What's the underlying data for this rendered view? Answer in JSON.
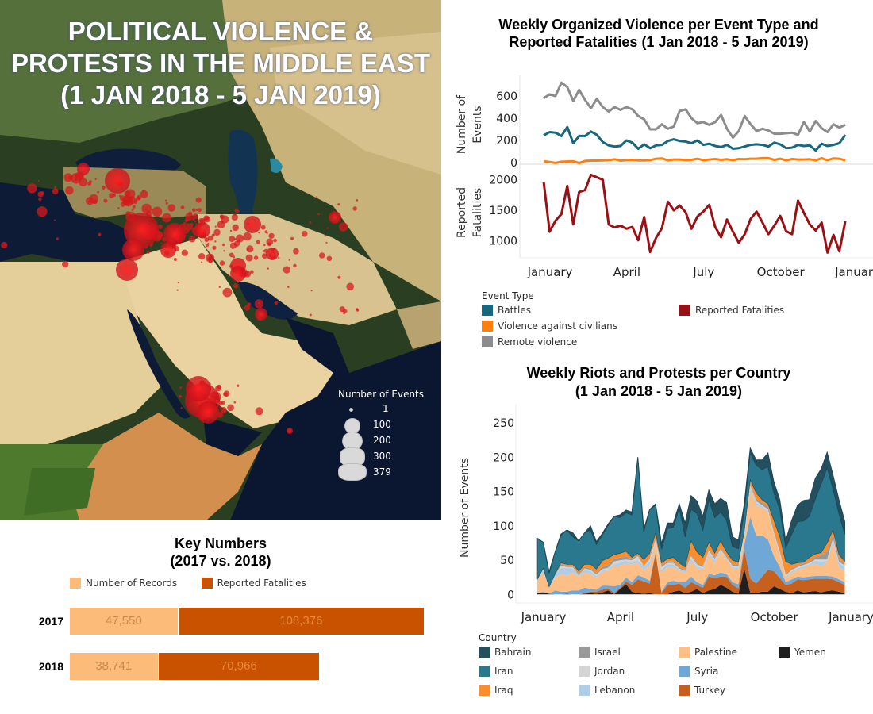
{
  "map": {
    "title_lines": [
      "POLITICAL VIOLENCE &",
      "PROTESTS IN THE MIDDLE EAST",
      "(1 JAN 2018 - 5 JAN 2019)"
    ],
    "legend": {
      "title": "Number of Events",
      "entries": [
        {
          "label": "1",
          "value": 1
        },
        {
          "label": "100",
          "value": 100
        },
        {
          "label": "200",
          "value": 200
        },
        {
          "label": "300",
          "value": 300
        },
        {
          "label": "379",
          "value": 379
        }
      ]
    },
    "marker_color": "#d7191c"
  },
  "key_numbers": {
    "title_lines": [
      "Key Numbers",
      "(2017 vs. 2018)"
    ],
    "legend": [
      {
        "label": "Number of Records",
        "color": "#fdbb7a"
      },
      {
        "label": "Reported Fatalities",
        "color": "#c85200"
      }
    ]
  },
  "violence": {
    "title_lines": [
      "Weekly Organized Violence per Event Type and",
      "Reported Fatalities (1 Jan 2018 - 5 Jan 2019)"
    ],
    "legend_title": "Event Type",
    "legend": [
      {
        "label": "Battles",
        "color": "#17677e"
      },
      {
        "label": "Violence against civilians",
        "color": "#ff7f0e"
      },
      {
        "label": "Remote violence",
        "color": "#8c8c8c"
      }
    ],
    "fatalities_legend": {
      "label": "Reported Fatalities",
      "color": "#9b1015"
    }
  },
  "protests": {
    "title_lines": [
      "Weekly Riots and Protests per Country",
      "(1 Jan 2018 - 5 Jan 2019)"
    ],
    "legend_title": "Country"
  },
  "chart_data": [
    {
      "type": "bar",
      "title": "Key Numbers (2017 vs. 2018)",
      "stacked": true,
      "orientation": "horizontal",
      "categories": [
        "2017",
        "2018"
      ],
      "series": [
        {
          "name": "Number of Records",
          "values": [
            47550,
            38741
          ],
          "labels": [
            "47,550",
            "38,741"
          ],
          "color": "#fdbb7a"
        },
        {
          "name": "Reported Fatalities",
          "values": [
            108376,
            70966
          ],
          "labels": [
            "108,376",
            "70,966"
          ],
          "color": "#c85200"
        }
      ]
    },
    {
      "type": "line",
      "title": "Weekly Organized Violence per Event Type (Number of Events)",
      "ylabel": "Number of Events",
      "ylim": [
        0,
        750
      ],
      "yticks": [
        0,
        200,
        400,
        600
      ],
      "x_month_labels": [
        {
          "label": "January",
          "week": 1
        },
        {
          "label": "April",
          "week": 14
        },
        {
          "label": "July",
          "week": 27
        },
        {
          "label": "October",
          "week": 40
        },
        {
          "label": "January",
          "week": 53
        }
      ],
      "x_weeks": 54,
      "series": [
        {
          "name": "Remote violence",
          "color": "#8c8c8c",
          "values": [
            580,
            615,
            600,
            720,
            680,
            555,
            655,
            565,
            490,
            575,
            500,
            460,
            500,
            475,
            500,
            480,
            420,
            390,
            300,
            300,
            345,
            305,
            325,
            465,
            480,
            400,
            355,
            365,
            340,
            365,
            430,
            305,
            225,
            285,
            420,
            345,
            285,
            305,
            290,
            260,
            260,
            265,
            270,
            250,
            365,
            280,
            375,
            310,
            275,
            345,
            315,
            340
          ]
        },
        {
          "name": "Battles",
          "color": "#17677e",
          "values": [
            245,
            275,
            270,
            240,
            320,
            175,
            240,
            240,
            280,
            250,
            185,
            155,
            145,
            150,
            200,
            180,
            125,
            165,
            130,
            155,
            160,
            195,
            210,
            195,
            190,
            175,
            200,
            160,
            170,
            150,
            140,
            160,
            125,
            130,
            145,
            160,
            165,
            160,
            145,
            180,
            165,
            130,
            135,
            160,
            150,
            155,
            110,
            170,
            150,
            160,
            175,
            250
          ]
        },
        {
          "name": "Violence against civilians",
          "color": "#ff7f0e",
          "values": [
            12,
            6,
            -2,
            8,
            10,
            12,
            -3,
            15,
            18,
            18,
            20,
            22,
            30,
            18,
            22,
            25,
            20,
            20,
            22,
            35,
            38,
            20,
            28,
            28,
            22,
            25,
            35,
            22,
            28,
            32,
            25,
            30,
            22,
            32,
            30,
            35,
            35,
            40,
            40,
            25,
            35,
            20,
            32,
            28,
            28,
            30,
            20,
            40,
            22,
            38,
            35,
            20
          ]
        }
      ]
    },
    {
      "type": "line",
      "title": "Reported Fatalities (weekly)",
      "ylabel": "Reported Fatalities",
      "ylim": [
        750,
        2150
      ],
      "yticks": [
        1000,
        1500,
        2000
      ],
      "x_weeks": 54,
      "series": [
        {
          "name": "Reported Fatalities",
          "color": "#9b1015",
          "values": [
            1970,
            1150,
            1330,
            1440,
            1900,
            1270,
            1800,
            1830,
            2080,
            2040,
            2000,
            1270,
            1220,
            1250,
            1200,
            1230,
            1010,
            1390,
            820,
            1050,
            1210,
            1640,
            1500,
            1580,
            1470,
            1200,
            1400,
            1480,
            1590,
            1230,
            1060,
            1350,
            1150,
            970,
            1110,
            1360,
            1480,
            1300,
            1110,
            1250,
            1410,
            1160,
            1110,
            1660,
            1460,
            1270,
            1170,
            1300,
            810,
            1100,
            830,
            1320
          ]
        }
      ]
    },
    {
      "type": "area",
      "stacked": true,
      "title": "Weekly Riots and Protests per Country (1 Jan 2018 - 5 Jan 2019)",
      "ylabel": "Number of Events",
      "ylim": [
        -10,
        265
      ],
      "yticks": [
        0,
        50,
        100,
        150,
        200,
        250
      ],
      "x_month_labels": [
        {
          "label": "January",
          "week": 1
        },
        {
          "label": "April",
          "week": 14
        },
        {
          "label": "July",
          "week": 27
        },
        {
          "label": "October",
          "week": 40
        },
        {
          "label": "January",
          "week": 53
        }
      ],
      "x_weeks": 54,
      "legend_order": [
        "Bahrain",
        "Israel",
        "Palestine",
        "Yemen",
        "Iran",
        "Jordan",
        "Syria",
        "Iraq",
        "Lebanon",
        "Turkey"
      ],
      "series": [
        {
          "name": "Yemen",
          "color": "#1f1f1f",
          "values": [
            2,
            3,
            1,
            -2,
            0,
            1,
            -1,
            -1,
            1,
            2,
            1,
            3,
            6,
            0,
            8,
            15,
            4,
            2,
            1,
            2,
            -6,
            0,
            0,
            4,
            6,
            2,
            4,
            8,
            2,
            6,
            8,
            14,
            10,
            4,
            1,
            38,
            3,
            2,
            4,
            4,
            12,
            8,
            4,
            2,
            6,
            3,
            4,
            5,
            3,
            5,
            6,
            4,
            2
          ]
        },
        {
          "name": "Turkey",
          "color": "#c8601d",
          "values": [
            0,
            0,
            0,
            0,
            0,
            0,
            0,
            0,
            1,
            2,
            3,
            4,
            3,
            2,
            2,
            4,
            10,
            20,
            18,
            14,
            60,
            2,
            14,
            10,
            10,
            8,
            14,
            6,
            8,
            20,
            16,
            12,
            16,
            10,
            8,
            28,
            20,
            14,
            22,
            32,
            22,
            16,
            10,
            14,
            16,
            18,
            18,
            18,
            20,
            18,
            16,
            14,
            12
          ]
        },
        {
          "name": "Syria",
          "color": "#6fa7d6",
          "values": [
            0,
            1,
            0,
            6,
            4,
            3,
            6,
            6,
            8,
            4,
            3,
            6,
            4,
            10,
            4,
            6,
            4,
            6,
            6,
            4,
            2,
            2,
            4,
            6,
            2,
            8,
            8,
            4,
            4,
            4,
            4,
            6,
            4,
            4,
            6,
            6,
            90,
            70,
            60,
            44,
            22,
            16,
            4,
            6,
            4,
            4,
            4,
            4,
            4,
            4,
            4,
            4,
            4
          ]
        },
        {
          "name": "Palestine",
          "color": "#fdbf86",
          "values": [
            20,
            28,
            10,
            18,
            26,
            24,
            26,
            20,
            22,
            22,
            18,
            20,
            22,
            30,
            28,
            20,
            26,
            18,
            10,
            22,
            14,
            28,
            22,
            20,
            16,
            14,
            22,
            20,
            22,
            28,
            18,
            30,
            22,
            20,
            22,
            10,
            40,
            44,
            40,
            40,
            30,
            18,
            6,
            10,
            10,
            14,
            16,
            18,
            14,
            20,
            50,
            18,
            16
          ]
        },
        {
          "name": "Lebanon",
          "color": "#aecde9",
          "values": [
            0,
            4,
            0,
            4,
            8,
            10,
            6,
            2,
            4,
            4,
            2,
            2,
            2,
            2,
            4,
            4,
            2,
            4,
            6,
            6,
            2,
            4,
            4,
            4,
            2,
            2,
            4,
            2,
            2,
            4,
            4,
            2,
            2,
            2,
            2,
            4,
            4,
            4,
            2,
            2,
            2,
            2,
            2,
            2,
            2,
            2,
            2,
            4,
            6,
            2,
            4,
            6,
            6
          ]
        },
        {
          "name": "Jordan",
          "color": "#d4d4d4",
          "values": [
            0,
            2,
            0,
            0,
            4,
            2,
            2,
            0,
            2,
            2,
            2,
            2,
            2,
            4,
            4,
            2,
            4,
            6,
            0,
            4,
            2,
            4,
            2,
            2,
            2,
            0,
            4,
            4,
            2,
            2,
            2,
            2,
            0,
            2,
            2,
            2,
            2,
            2,
            2,
            2,
            2,
            2,
            2,
            2,
            2,
            2,
            2,
            2,
            4,
            2,
            2,
            2,
            2
          ]
        },
        {
          "name": "Israel",
          "color": "#999999",
          "values": [
            0,
            0,
            0,
            2,
            2,
            2,
            2,
            2,
            2,
            2,
            2,
            4,
            4,
            4,
            4,
            4,
            2,
            2,
            0,
            2,
            2,
            2,
            2,
            2,
            2,
            2,
            2,
            2,
            2,
            2,
            2,
            2,
            2,
            2,
            2,
            2,
            2,
            2,
            4,
            4,
            2,
            2,
            2,
            2,
            2,
            2,
            2,
            4,
            6,
            12,
            6,
            4,
            2
          ]
        },
        {
          "name": "Iraq",
          "color": "#fc8d2b",
          "values": [
            0,
            0,
            0,
            0,
            2,
            2,
            2,
            4,
            4,
            6,
            6,
            8,
            10,
            6,
            6,
            8,
            2,
            2,
            10,
            6,
            8,
            4,
            4,
            6,
            6,
            4,
            20,
            16,
            12,
            10,
            6,
            10,
            6,
            6,
            4,
            2,
            6,
            10,
            4,
            4,
            16,
            20,
            18,
            6,
            4,
            2,
            6,
            4,
            4,
            12,
            6,
            6,
            4
          ]
        },
        {
          "name": "Iran",
          "color": "#2a788e",
          "values": [
            60,
            38,
            20,
            32,
            40,
            50,
            40,
            44,
            46,
            50,
            36,
            38,
            48,
            56,
            52,
            56,
            62,
            140,
            40,
            64,
            40,
            20,
            44,
            44,
            80,
            44,
            46,
            56,
            40,
            62,
            52,
            42,
            46,
            20,
            20,
            30,
            40,
            40,
            44,
            54,
            40,
            40,
            20,
            44,
            60,
            60,
            60,
            80,
            100,
            110,
            60,
            60,
            40
          ]
        },
        {
          "name": "Bahrain",
          "color": "#244f5f",
          "values": [
            0,
            0,
            2,
            0,
            2,
            0,
            6,
            0,
            0,
            6,
            4,
            2,
            2,
            0,
            4,
            4,
            4,
            0,
            4,
            0,
            2,
            8,
            8,
            6,
            6,
            20,
            20,
            18,
            20,
            14,
            20,
            20,
            26,
            14,
            12,
            10,
            6,
            8,
            14,
            20,
            16,
            14,
            10,
            20,
            24,
            30,
            24,
            30,
            22,
            22,
            20,
            20,
            18
          ]
        }
      ]
    }
  ]
}
